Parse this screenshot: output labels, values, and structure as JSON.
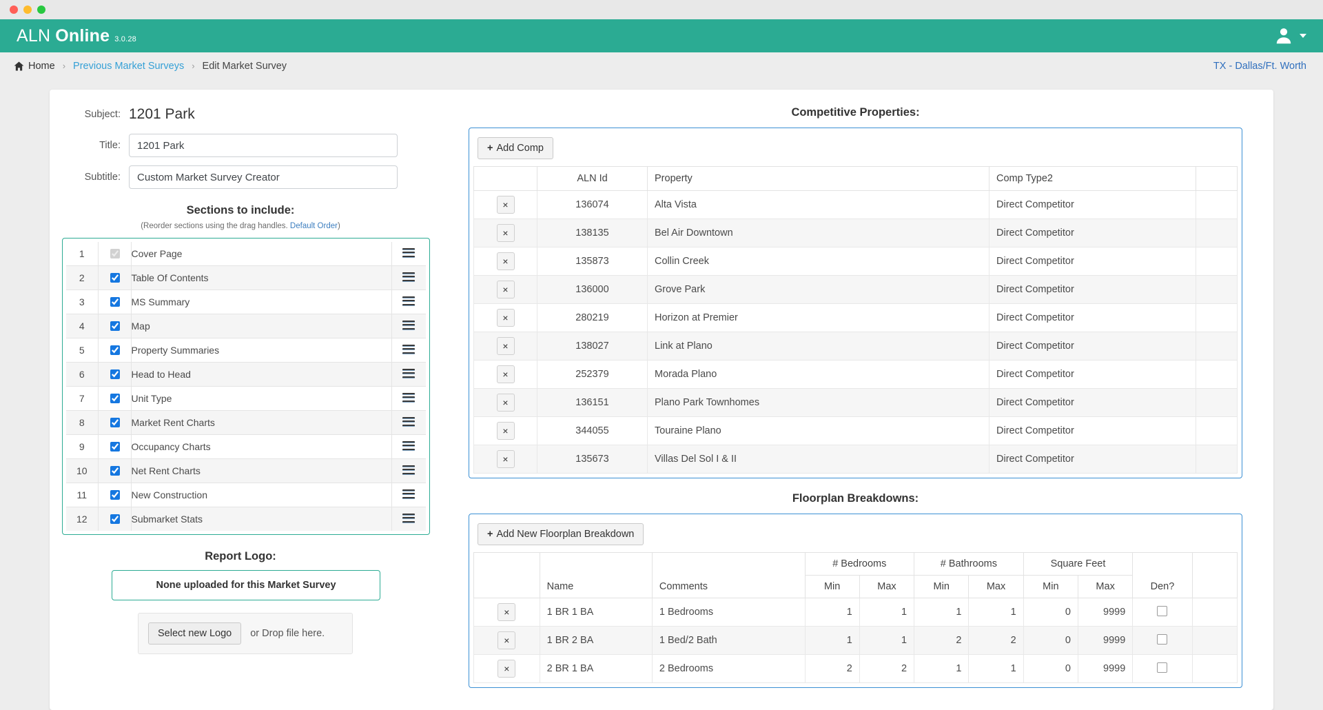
{
  "window": {
    "dots": [
      "close",
      "minimize",
      "maximize"
    ]
  },
  "appbar": {
    "brand_first": "ALN",
    "brand_second": "Online",
    "version": "3.0.28"
  },
  "breadcrumb": {
    "home": "Home",
    "previous": "Previous Market Surveys",
    "current": "Edit Market Survey",
    "separator": "›",
    "region": "TX - Dallas/Ft. Worth"
  },
  "form": {
    "subject_label": "Subject:",
    "subject_value": "1201 Park",
    "title_label": "Title:",
    "title_value": "1201 Park",
    "subtitle_label": "Subtitle:",
    "subtitle_value": "Custom Market Survey Creator"
  },
  "sections": {
    "heading": "Sections to include:",
    "hint_prefix": "(Reorder sections using the drag handles. ",
    "hint_link": "Default Order",
    "hint_suffix": ")",
    "items": [
      {
        "num": "1",
        "label": "Cover Page",
        "checked": true,
        "disabled": true
      },
      {
        "num": "2",
        "label": "Table Of Contents",
        "checked": true,
        "disabled": false
      },
      {
        "num": "3",
        "label": "MS Summary",
        "checked": true,
        "disabled": false
      },
      {
        "num": "4",
        "label": "Map",
        "checked": true,
        "disabled": false
      },
      {
        "num": "5",
        "label": "Property Summaries",
        "checked": true,
        "disabled": false
      },
      {
        "num": "6",
        "label": "Head to Head",
        "checked": true,
        "disabled": false
      },
      {
        "num": "7",
        "label": "Unit Type",
        "checked": true,
        "disabled": false
      },
      {
        "num": "8",
        "label": "Market Rent Charts",
        "checked": true,
        "disabled": false
      },
      {
        "num": "9",
        "label": "Occupancy Charts",
        "checked": true,
        "disabled": false
      },
      {
        "num": "10",
        "label": "Net Rent Charts",
        "checked": true,
        "disabled": false
      },
      {
        "num": "11",
        "label": "New Construction",
        "checked": true,
        "disabled": false
      },
      {
        "num": "12",
        "label": "Submarket Stats",
        "checked": true,
        "disabled": false
      }
    ]
  },
  "logo": {
    "heading": "Report Logo:",
    "status": "None uploaded for this Market Survey",
    "select_button": "Select new Logo",
    "drop_text": "or Drop file here."
  },
  "competitive": {
    "heading": "Competitive Properties:",
    "add_button": "Add Comp",
    "add_icon": "plus-icon",
    "columns": [
      "",
      "ALN Id",
      "Property",
      "Comp Type2",
      ""
    ],
    "rows": [
      {
        "id": "136074",
        "property": "Alta Vista",
        "type": "Direct Competitor"
      },
      {
        "id": "138135",
        "property": "Bel Air Downtown",
        "type": "Direct Competitor"
      },
      {
        "id": "135873",
        "property": "Collin Creek",
        "type": "Direct Competitor"
      },
      {
        "id": "136000",
        "property": "Grove Park",
        "type": "Direct Competitor"
      },
      {
        "id": "280219",
        "property": "Horizon at Premier",
        "type": "Direct Competitor"
      },
      {
        "id": "138027",
        "property": "Link at Plano",
        "type": "Direct Competitor"
      },
      {
        "id": "252379",
        "property": "Morada Plano",
        "type": "Direct Competitor"
      },
      {
        "id": "136151",
        "property": "Plano Park Townhomes",
        "type": "Direct Competitor"
      },
      {
        "id": "344055",
        "property": "Touraine Plano",
        "type": "Direct Competitor"
      },
      {
        "id": "135673",
        "property": "Villas Del Sol I & II",
        "type": "Direct Competitor"
      }
    ],
    "delete_label": "×"
  },
  "floorplan": {
    "heading": "Floorplan Breakdowns:",
    "add_button": "Add New Floorplan Breakdown",
    "add_icon": "plus-icon",
    "group_headers": {
      "bedrooms": "# Bedrooms",
      "bathrooms": "# Bathrooms",
      "sqft": "Square Feet"
    },
    "columns": {
      "name": "Name",
      "comments": "Comments",
      "min": "Min",
      "max": "Max",
      "den": "Den?"
    },
    "rows": [
      {
        "name": "1 BR 1 BA",
        "comments": "1 Bedrooms",
        "bed_min": "1",
        "bed_max": "1",
        "bath_min": "1",
        "bath_max": "1",
        "sf_min": "0",
        "sf_max": "9999",
        "den": false
      },
      {
        "name": "1 BR 2 BA",
        "comments": "1 Bed/2 Bath",
        "bed_min": "1",
        "bed_max": "1",
        "bath_min": "2",
        "bath_max": "2",
        "sf_min": "0",
        "sf_max": "9999",
        "den": false
      },
      {
        "name": "2 BR 1 BA",
        "comments": "2 Bedrooms",
        "bed_min": "2",
        "bed_max": "2",
        "bath_min": "1",
        "bath_max": "1",
        "sf_min": "0",
        "sf_max": "9999",
        "den": false
      }
    ],
    "delete_label": "×"
  },
  "colors": {
    "appbar": "#2bab93",
    "accent_border": "#2bab93",
    "panel_border": "#3a8fd4",
    "link": "#35a0d6",
    "region_link": "#2f6fbd",
    "checkbox": "#1577e0"
  }
}
